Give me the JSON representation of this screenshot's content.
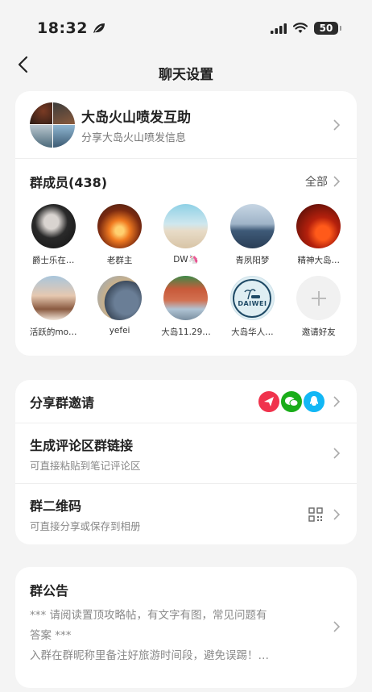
{
  "status": {
    "time": "18:32",
    "battery": "50"
  },
  "nav": {
    "title": "聊天设置"
  },
  "group": {
    "name": "大岛火山喷发互助",
    "subtitle": "分享大岛火山喷发信息"
  },
  "members": {
    "title": "群成员(438)",
    "all_label": "全部",
    "list": [
      {
        "name": "爵士乐在…"
      },
      {
        "name": "老群主"
      },
      {
        "name": "DW🦄"
      },
      {
        "name": "青夙阳梦"
      },
      {
        "name": "精神大岛…"
      },
      {
        "name": "活跃的mo…"
      },
      {
        "name": "yefei"
      },
      {
        "name": "大岛11.29…"
      },
      {
        "name": "大岛华人…"
      },
      {
        "name": "邀请好友"
      }
    ],
    "daiwei_text": "DAIWEI"
  },
  "actions": {
    "share_invite": "分享群邀请",
    "comment_link_title": "生成评论区群链接",
    "comment_link_sub": "可直接粘贴到笔记评论区",
    "qr_title": "群二维码",
    "qr_sub": "可直接分享或保存到相册"
  },
  "announcement": {
    "title": "群公告",
    "line1": "*** 请阅读置顶攻略帖，有文字有图，常见问题有",
    "line2": "答案 ***",
    "line3": "入群在群昵称里备注好旅游时间段，避免误踢！…"
  },
  "colors": {
    "red": "#f0334d",
    "wechat": "#1aad19",
    "qq": "#12b7f5"
  }
}
